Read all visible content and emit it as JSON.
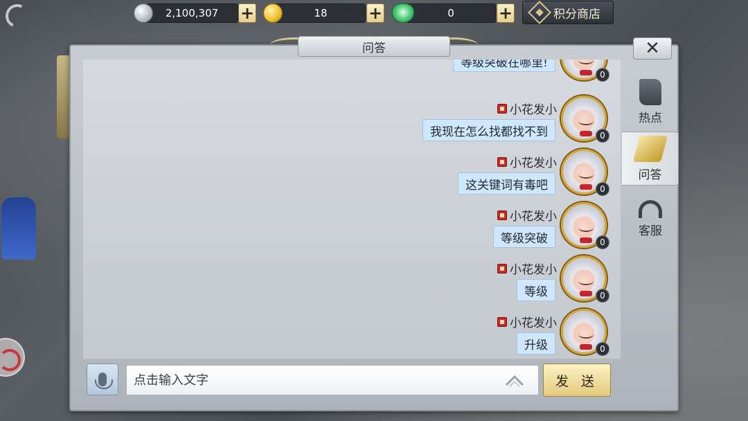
{
  "currencies": [
    {
      "name": "silver-coin",
      "value": "2,100,307"
    },
    {
      "name": "gold-coin",
      "value": "18"
    },
    {
      "name": "jade-ingot",
      "value": "0"
    }
  ],
  "plus_label": "+",
  "shop_label": "积分商店",
  "dialog": {
    "title": "问答",
    "close_label": "✕"
  },
  "tabs": [
    {
      "label": "热点",
      "icon": "scroll-icon",
      "active": false
    },
    {
      "label": "问答",
      "icon": "gold-bars-icon",
      "active": true
    },
    {
      "label": "客服",
      "icon": "headset-icon",
      "active": false
    }
  ],
  "messages": [
    {
      "sender": "",
      "text": "等级突破在哪里!",
      "count": "0"
    },
    {
      "sender": "小花发小",
      "text": "我现在怎么找都找不到",
      "count": "0"
    },
    {
      "sender": "小花发小",
      "text": "这关键词有毒吧",
      "count": "0"
    },
    {
      "sender": "小花发小",
      "text": "等级突破",
      "count": "0"
    },
    {
      "sender": "小花发小",
      "text": "等级",
      "count": "0"
    },
    {
      "sender": "小花发小",
      "text": "升级",
      "count": "0"
    }
  ],
  "input": {
    "placeholder": "点击输入文字",
    "value": ""
  },
  "send_label": "发 送"
}
